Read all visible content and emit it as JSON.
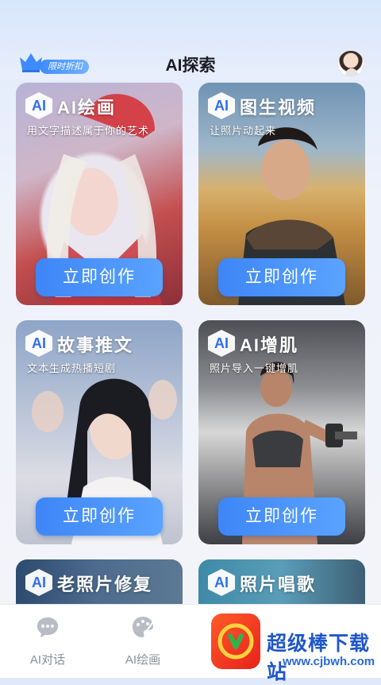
{
  "header": {
    "promo_badge": "限时折扣",
    "title": "AI探索"
  },
  "cards": [
    {
      "logo": "AI",
      "title": "AI绘画",
      "subtitle": "用文字描述属于你的艺术",
      "cta": "立即创作"
    },
    {
      "logo": "AI",
      "title": "图生视频",
      "subtitle": "让照片动起来",
      "cta": "立即创作"
    },
    {
      "logo": "AI",
      "title": "故事推文",
      "subtitle": "文本生成热播短剧",
      "cta": "立即创作"
    },
    {
      "logo": "AI",
      "title": "AI增肌",
      "subtitle": "照片导入一键增肌",
      "cta": "立即创作"
    },
    {
      "logo": "AI",
      "title": "老照片修复",
      "subtitle": "",
      "cta": ""
    },
    {
      "logo": "AI",
      "title": "照片唱歌",
      "subtitle": "",
      "cta": ""
    }
  ],
  "tabbar": {
    "items": [
      {
        "label": "AI对话",
        "icon": "chat-bubble-icon"
      },
      {
        "label": "AI绘画",
        "icon": "palette-icon"
      }
    ]
  },
  "watermark": {
    "text": "超级棒下载站",
    "url": "www.cjbwh.com"
  }
}
